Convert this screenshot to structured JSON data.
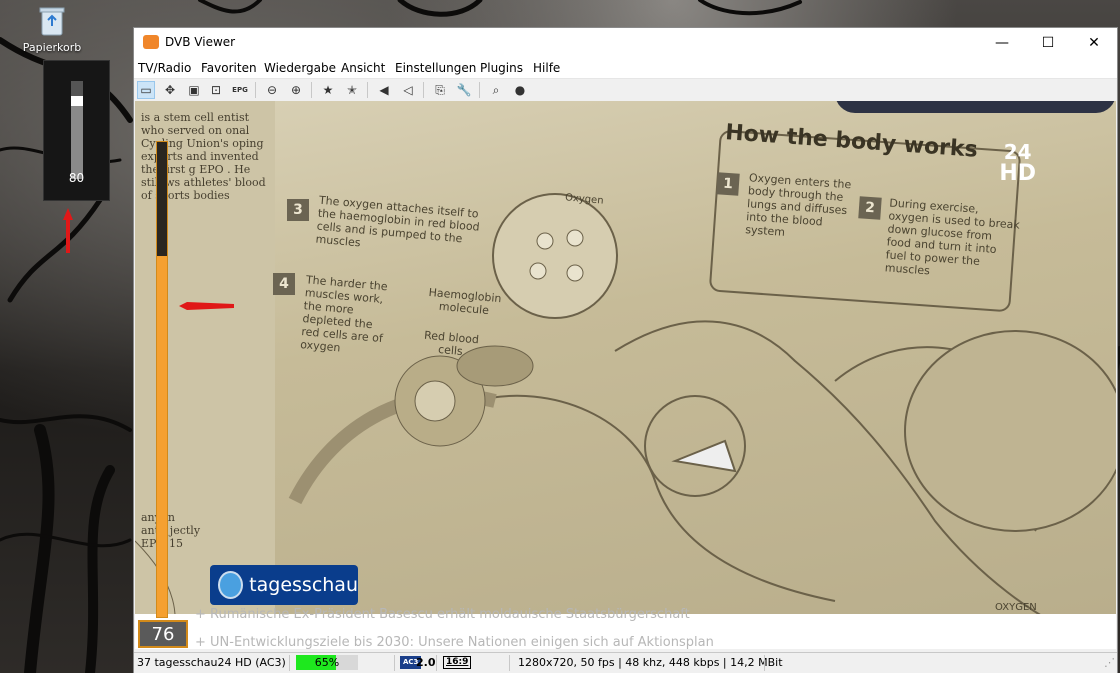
{
  "desktop": {
    "recycle_bin_label": "Papierkorb",
    "volume_value": "80",
    "volume_level": 0.8
  },
  "window": {
    "title": "DVB Viewer",
    "controls": {
      "minimize": "—",
      "maximize": "☐",
      "close": "✕"
    }
  },
  "menu": [
    {
      "label": "TV/Radio"
    },
    {
      "label": "Favoriten"
    },
    {
      "label": "Wiedergabe"
    },
    {
      "label": "Ansicht"
    },
    {
      "label": "Einstellungen"
    },
    {
      "label": "Plugins"
    },
    {
      "label": "Hilfe"
    }
  ],
  "toolbar": {
    "epg_label": "EPG"
  },
  "video": {
    "channel_logo_top": "24",
    "channel_logo_bottom": "HD",
    "broadcaster_logo": "tagesschau",
    "article": {
      "title": "How the body works",
      "step1_num": "1",
      "step1_text": "Oxygen enters the body through the lungs and diffuses into the blood system",
      "step2_num": "2",
      "step2_text": "During exercise, oxygen is used to break down glucose from food and turn it into fuel to power the muscles",
      "step3_num": "3",
      "step3_text": "The oxygen attaches itself to the haemoglobin in red blood cells and is pumped to the muscles",
      "step4_num": "4",
      "step4_text": "The harder the muscles work, the more depleted the red cells are of oxygen",
      "label_oxygen": "Oxygen",
      "label_haemoglobin": "Haemoglobin molecule",
      "label_red_blood": "Red blood cells",
      "label_oxygen_bottom": "OXYGEN",
      "left_column": "is a stem cell entist who served on onal Cycling Union's oping experts and invented the first g EPO . He still ws athletes' blood of sports bodies",
      "left_column_bottom": "any in anti- jectly EPO 15"
    },
    "ticker_line1": "+ Rumänische Ex-Präsident Basescu erhält moldauische Staatsbürgerschaft",
    "ticker_line2": "+ UN-Entwicklungsziele bis 2030: Unsere Nationen einigen sich auf Aktionsplan",
    "level_value": "76",
    "level_fraction": 0.76
  },
  "status": {
    "channel": "37 tagesschau24 HD (AC3)",
    "signal_text": "65%",
    "signal_level": 0.65,
    "audio_badge": "AC3",
    "audio_channels": "2.0",
    "aspect": "16:9",
    "stream_info": "1280x720, 50 fps | 48 khz, 448 kbps | 14,2 MBit"
  }
}
